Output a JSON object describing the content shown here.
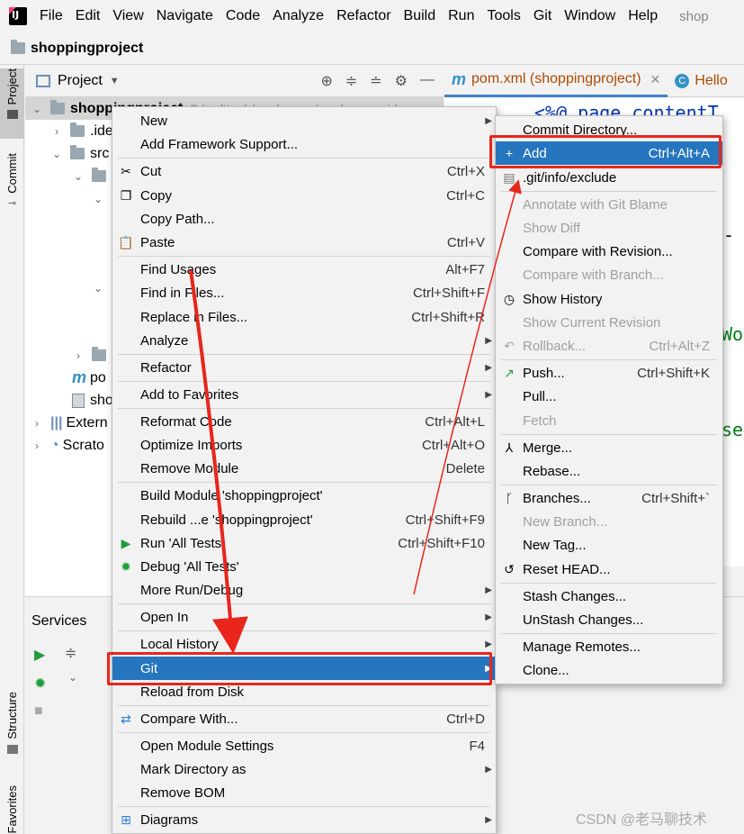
{
  "menubar": {
    "items": [
      "File",
      "Edit",
      "View",
      "Navigate",
      "Code",
      "Analyze",
      "Refactor",
      "Build",
      "Run",
      "Tools",
      "Git",
      "Window",
      "Help"
    ],
    "project_title": "shop"
  },
  "breadcrumb": {
    "project": "shoppingproject"
  },
  "stripe": {
    "project": "Project",
    "commit": "Commit",
    "structure": "Structure",
    "favorites": "Favorites"
  },
  "project_panel": {
    "title": "Project",
    "tree": [
      {
        "label": "shoppingproject",
        "path": "D:\\softtools\\workspace\\workspace_idea"
      },
      {
        "label": ".ide"
      },
      {
        "label": "src"
      },
      {
        "label": ""
      },
      {
        "label": "po"
      },
      {
        "label": "sho"
      },
      {
        "label": "Extern"
      },
      {
        "label": "Scrato"
      }
    ]
  },
  "editor": {
    "tabs": [
      {
        "label": "pom.xml (shoppingproject)",
        "icon": "m"
      },
      {
        "label": "Hello",
        "icon": "C"
      }
    ],
    "code_lines": [
      "<%@ page contentT",
      "-",
      "Wo",
      "se"
    ]
  },
  "services": {
    "title": "Services"
  },
  "context_menu": {
    "new": "New",
    "add_framework": "Add Framework Support...",
    "cut": "Cut",
    "cut_sc": "Ctrl+X",
    "copy": "Copy",
    "copy_sc": "Ctrl+C",
    "copy_path": "Copy Path...",
    "paste": "Paste",
    "paste_sc": "Ctrl+V",
    "find_usages": "Find Usages",
    "find_usages_sc": "Alt+F7",
    "find_in_files": "Find in Files...",
    "find_in_files_sc": "Ctrl+Shift+F",
    "replace_in_files": "Replace in Files...",
    "replace_in_files_sc": "Ctrl+Shift+R",
    "analyze": "Analyze",
    "refactor": "Refactor",
    "add_to_favorites": "Add to Favorites",
    "reformat_code": "Reformat Code",
    "reformat_code_sc": "Ctrl+Alt+L",
    "optimize_imports": "Optimize Imports",
    "optimize_imports_sc": "Ctrl+Alt+O",
    "remove_module": "Remove Module",
    "remove_module_sc": "Delete",
    "build_module": "Build Module 'shoppingproject'",
    "rebuild": "Rebuild ...e 'shoppingproject'",
    "rebuild_sc": "Ctrl+Shift+F9",
    "run_tests": "Run 'All Tests'",
    "run_tests_sc": "Ctrl+Shift+F10",
    "debug_tests": "Debug 'All Tests'",
    "more_run": "More Run/Debug",
    "open_in": "Open In",
    "local_history": "Local History",
    "git": "Git",
    "reload": "Reload from Disk",
    "compare_with": "Compare With...",
    "compare_with_sc": "Ctrl+D",
    "open_module_settings": "Open Module Settings",
    "open_module_settings_sc": "F4",
    "mark_directory": "Mark Directory as",
    "remove_bom": "Remove BOM",
    "diagrams": "Diagrams"
  },
  "git_submenu": {
    "commit_directory": "Commit Directory...",
    "add": "Add",
    "add_sc": "Ctrl+Alt+A",
    "exclude": ".git/info/exclude",
    "annotate": "Annotate with Git Blame",
    "show_diff": "Show Diff",
    "compare_revision": "Compare with Revision...",
    "compare_branch": "Compare with Branch...",
    "show_history": "Show History",
    "show_current_revision": "Show Current Revision",
    "rollback": "Rollback...",
    "rollback_sc": "Ctrl+Alt+Z",
    "push": "Push...",
    "push_sc": "Ctrl+Shift+K",
    "pull": "Pull...",
    "fetch": "Fetch",
    "merge": "Merge...",
    "rebase": "Rebase...",
    "branches": "Branches...",
    "branches_sc": "Ctrl+Shift+`",
    "new_branch": "New Branch...",
    "new_tag": "New Tag...",
    "reset_head": "Reset HEAD...",
    "stash": "Stash Changes...",
    "unstash": "UnStash Changes...",
    "manage_remotes": "Manage Remotes...",
    "clone": "Clone..."
  },
  "watermark": "CSDN @老马聊技术",
  "colors": {
    "highlight": "#2675bf",
    "annotation": "#e8261c",
    "disabled": "#a0a0a0"
  }
}
